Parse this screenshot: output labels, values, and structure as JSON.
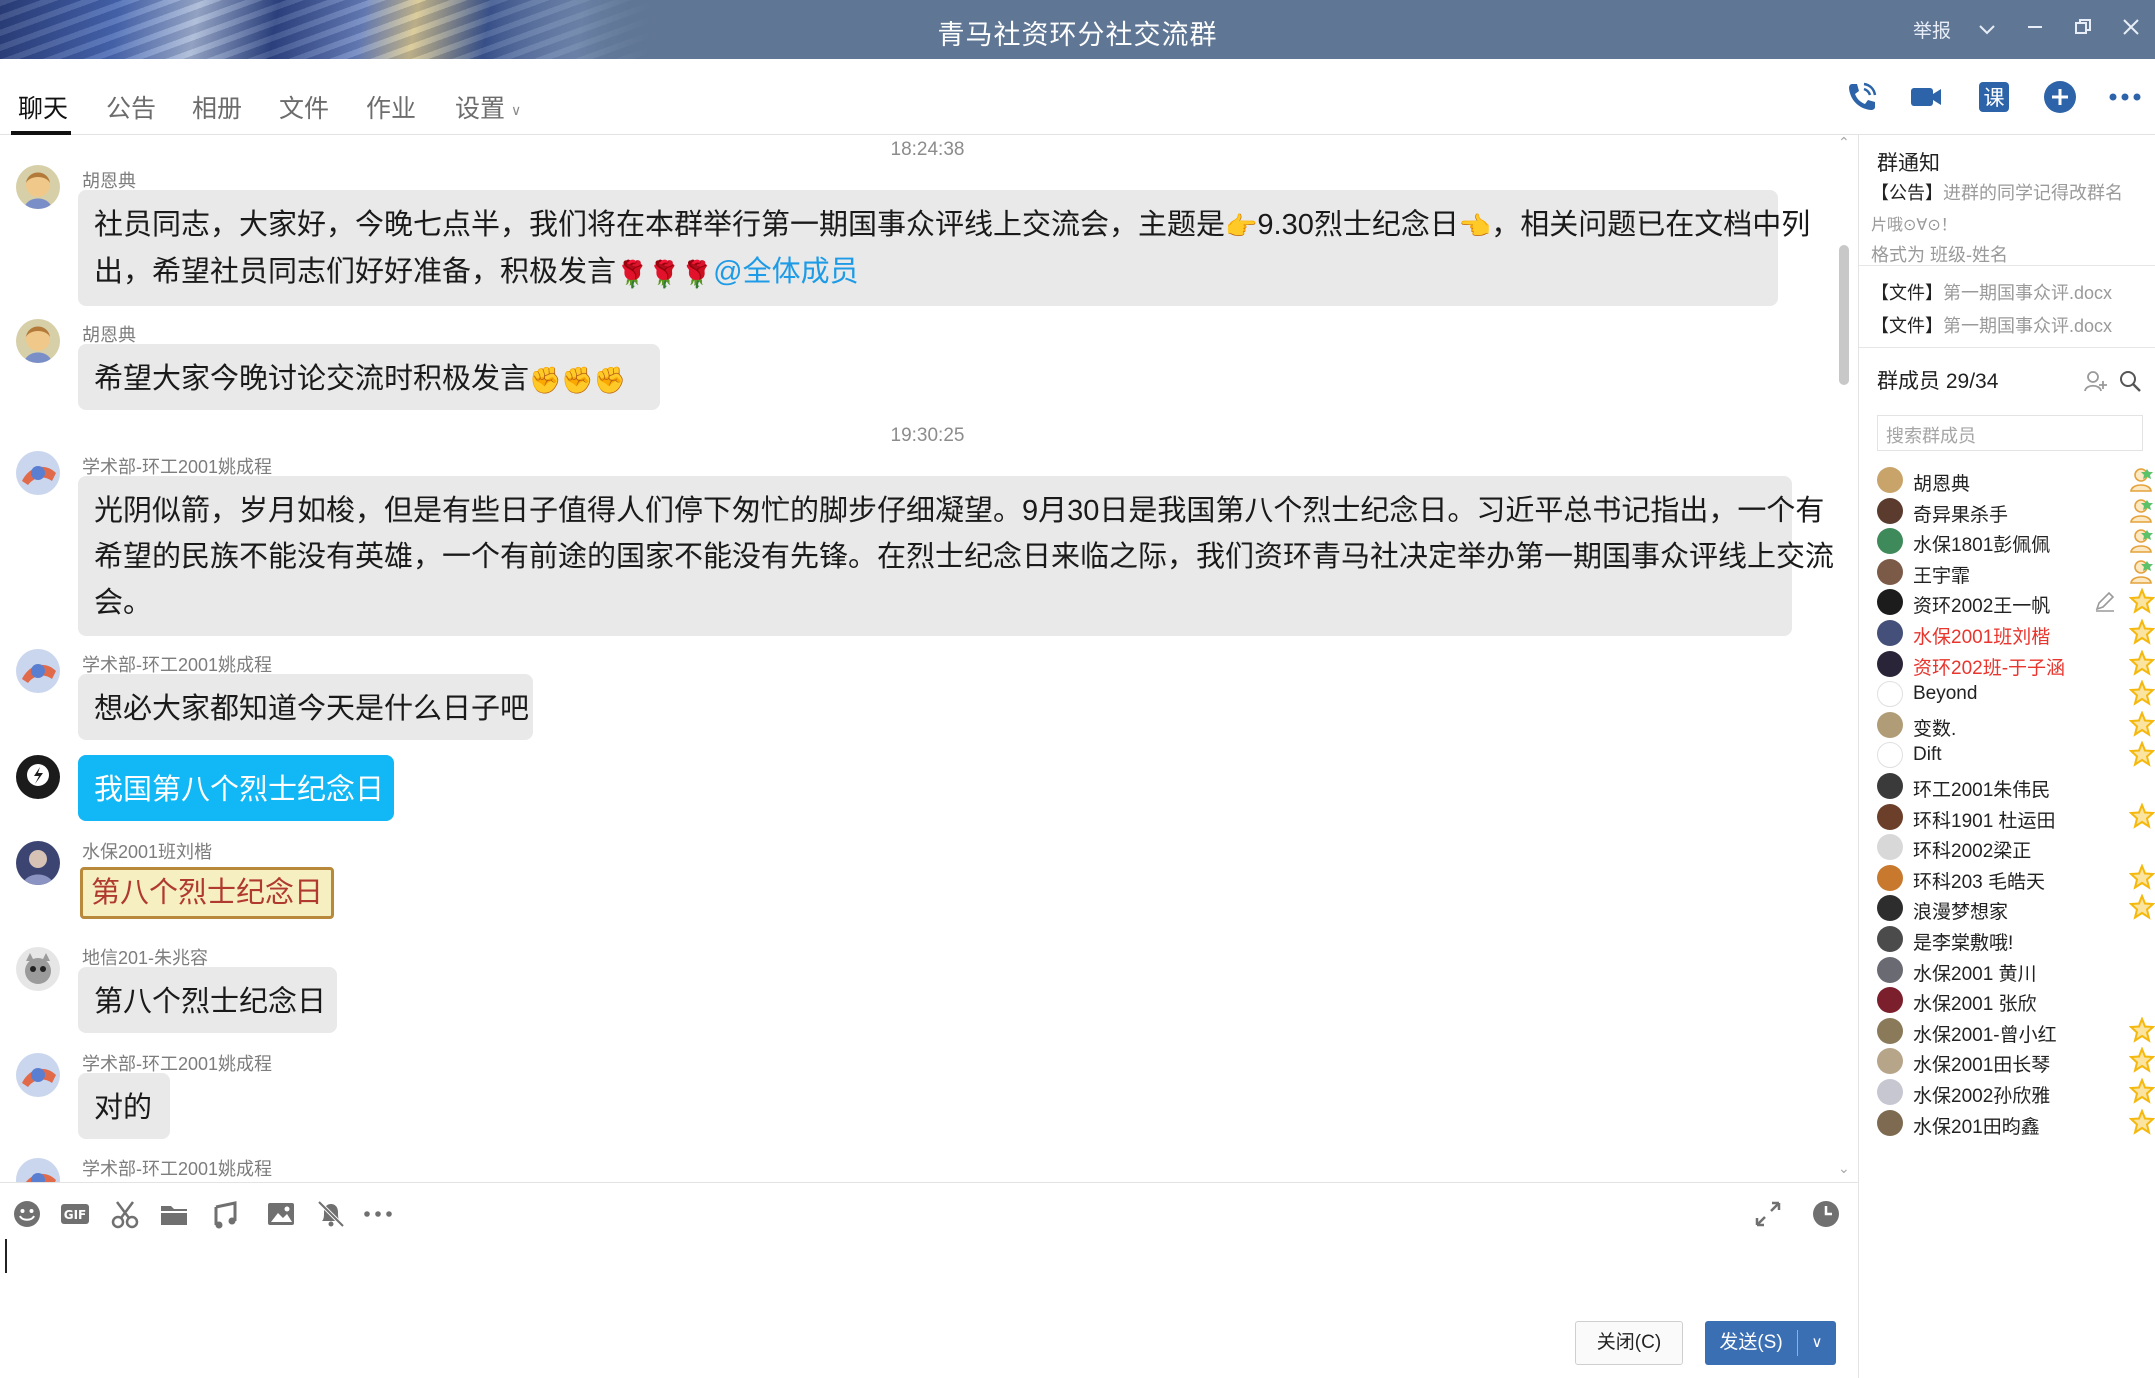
{
  "window": {
    "title": "青马社资环分社交流群",
    "report": "举报"
  },
  "tabs": [
    {
      "label": "聊天"
    },
    {
      "label": "公告"
    },
    {
      "label": "相册"
    },
    {
      "label": "文件"
    },
    {
      "label": "作业"
    },
    {
      "label": "设置"
    }
  ],
  "toolbar_icons": [
    "phone-call-icon",
    "video-call-icon",
    "class-icon",
    "add-app-icon",
    "more-icon"
  ],
  "chat": {
    "timestamps": [
      "18:24:38",
      "19:30:25"
    ],
    "messages": [
      {
        "sender": "胡恩典",
        "line1": "社员同志，大家好，今晚七点半，我们将在本群举行第一期国事众评线上交流会，主题是",
        "topic": "9.30烈士纪念日",
        "line1_end": "，相关问题已在文档中列",
        "line2": "出，希望社员同志们好好准备，积极发言",
        "roses": "🌹🌹🌹",
        "mention": "@全体成员"
      },
      {
        "sender": "胡恩典",
        "text": "希望大家今晚讨论交流时积极发言",
        "fists": "✊✊✊"
      },
      {
        "sender": "学术部-环工2001姚成程",
        "line1": "光阴似箭，岁月如梭，但是有些日子值得人们停下匆忙的脚步仔细凝望。9月30日是我国第八个烈士纪念日。习近平总书记指出，一个有",
        "line2": "希望的民族不能没有英雄，一个有前途的国家不能没有先锋。在烈士纪念日来临之际，我们资环青马社决定举办第一期国事众评线上交流",
        "line3": "会。"
      },
      {
        "sender": "学术部-环工2001姚成程",
        "text": "想必大家都知道今天是什么日子吧"
      },
      {
        "sender": "",
        "text": "我国第八个烈士纪念日",
        "self": true
      },
      {
        "sender": "水保2001班刘楷",
        "text": "第八个烈士纪念日",
        "sticker": true
      },
      {
        "sender": "地信201-朱兆容",
        "text": "第八个烈士纪念日"
      },
      {
        "sender": "学术部-环工2001姚成程",
        "text": "对的"
      },
      {
        "sender": "学术部-环工2001姚成程"
      }
    ]
  },
  "composer": {
    "close_label": "关闭(C)",
    "send_label": "发送(S)"
  },
  "panel": {
    "notice_title": "群通知",
    "notice_tag": "【公告】",
    "notice_text": "进群的同学记得改群名",
    "notice_text2": "片哦⊙∀⊙！",
    "notice_text3": "格式为 班级-姓名",
    "file_tag": "【文件】",
    "file1": "第一期国事众评.docx",
    "file2": "第一期国事众评.docx",
    "members_title": "群成员 29/34",
    "search_placeholder": "搜索群成员",
    "members": [
      {
        "name": "胡恩典",
        "role": "admin",
        "color": "#c9a46a"
      },
      {
        "name": "奇异果杀手",
        "role": "admin",
        "color": "#5a3b2e"
      },
      {
        "name": "水保1801彭佩佩",
        "role": "admin",
        "color": "#3f8a5a"
      },
      {
        "name": "王宇霏",
        "role": "admin",
        "color": "#7c5a48"
      },
      {
        "name": "资环2002王一帆",
        "role": "star",
        "color": "#1c1c1c",
        "edit": true
      },
      {
        "name": "水保2001班刘楷",
        "role": "star",
        "color": "#45507a",
        "red": true
      },
      {
        "name": "资环202班-于子涵",
        "role": "star",
        "color": "#2a2438",
        "red": true
      },
      {
        "name": "Beyond",
        "role": "star",
        "color": "#ffffff"
      },
      {
        "name": "变数.",
        "role": "star",
        "color": "#b09d78"
      },
      {
        "name": "Dift",
        "role": "star",
        "color": "#ffffff"
      },
      {
        "name": "环工2001朱伟民",
        "role": "none",
        "color": "#3a3a3a"
      },
      {
        "name": "环科1901 杜运田",
        "role": "star",
        "color": "#6b3f2a"
      },
      {
        "name": "环科2002梁正",
        "role": "none",
        "color": "#d8d8d8"
      },
      {
        "name": "环科203  毛皓天",
        "role": "star",
        "color": "#c8792e"
      },
      {
        "name": "浪漫梦想家",
        "role": "star",
        "color": "#2d2d2d"
      },
      {
        "name": "是李棠敷哦!",
        "role": "none",
        "color": "#4b4b4b"
      },
      {
        "name": "水保2001 黄川",
        "role": "none",
        "color": "#6a6a72"
      },
      {
        "name": "水保2001 张欣",
        "role": "none",
        "color": "#7a1f2b"
      },
      {
        "name": "水保2001-曾小红",
        "role": "star",
        "color": "#8a7a5a"
      },
      {
        "name": "水保2001田长琴",
        "role": "star",
        "color": "#b7a58a"
      },
      {
        "name": "水保2002孙欣雅",
        "role": "star",
        "color": "#c7c7d2"
      },
      {
        "name": "水保201田昀鑫",
        "role": "star",
        "color": "#7d6a50"
      }
    ]
  },
  "colors": {
    "titlebar": "#5f7694",
    "self_bubble": "#12b7f5",
    "other_bubble": "#e9e9e9",
    "mention": "#1e9be6",
    "send_button": "#3b6fb4",
    "red_name": "#e8352d",
    "star": "#f5b80d"
  }
}
